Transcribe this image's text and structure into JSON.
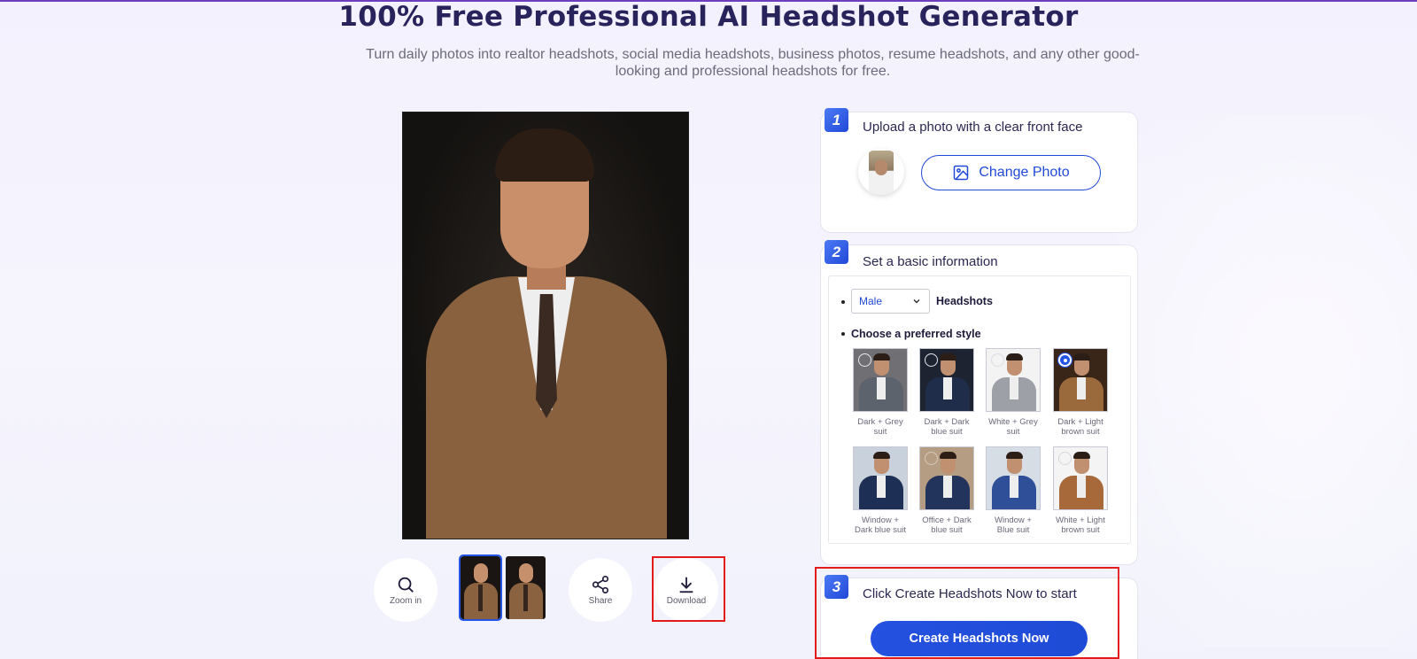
{
  "header": {
    "title": "100% Free Professional AI Headshot Generator",
    "subtitle": "Turn daily photos into realtor headshots, social media headshots, business photos, resume headshots, and any other good-looking and professional headshots for free."
  },
  "toolbar": {
    "zoom_label": "Zoom in",
    "share_label": "Share",
    "download_label": "Download"
  },
  "step1": {
    "number": "1",
    "text": "Upload a photo with a clear front face",
    "change_photo_label": "Change Photo"
  },
  "step2": {
    "number": "2",
    "text": "Set a basic information",
    "gender_value": "Male",
    "headshots_label": "Headshots",
    "style_prompt": "Choose a preferred style",
    "styles": [
      {
        "line1": "Dark + Grey",
        "line2": "suit"
      },
      {
        "line1": "Dark + Dark",
        "line2": "blue suit"
      },
      {
        "line1": "White + Grey",
        "line2": "suit"
      },
      {
        "line1": "Dark + Light",
        "line2": "brown suit"
      },
      {
        "line1": "Window +",
        "line2": "Dark blue suit"
      },
      {
        "line1": "Office + Dark",
        "line2": "blue suit"
      },
      {
        "line1": "Window +",
        "line2": "Blue suit"
      },
      {
        "line1": "White + Light",
        "line2": "brown suit"
      }
    ],
    "selected_style_index": 3
  },
  "step3": {
    "number": "3",
    "text": "Click Create Headshots Now to start",
    "create_label": "Create Headshots Now"
  },
  "colors": {
    "accent": "#2049d8",
    "highlight": "#e31b1b",
    "title": "#29235c"
  }
}
